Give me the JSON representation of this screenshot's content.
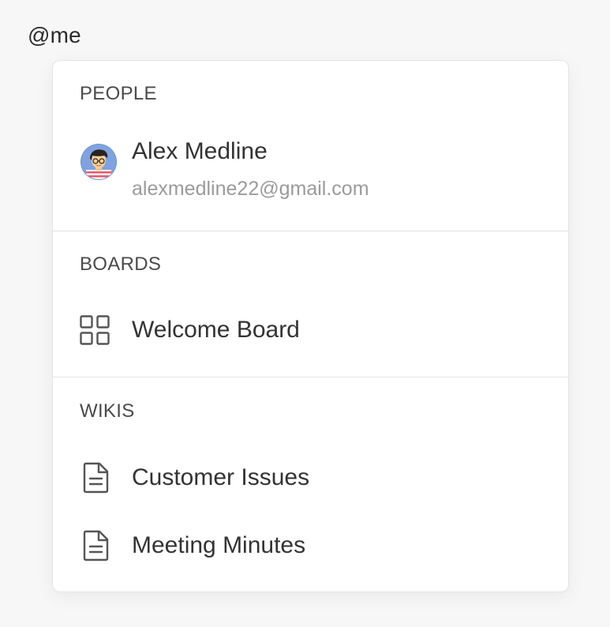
{
  "input": {
    "value": "@me"
  },
  "dropdown": {
    "people": {
      "header": "PEOPLE",
      "items": [
        {
          "name": "Alex Medline",
          "email": "alexmedline22@gmail.com",
          "icon": "avatar"
        }
      ]
    },
    "boards": {
      "header": "BOARDS",
      "items": [
        {
          "label": "Welcome Board",
          "icon": "board-grid-icon"
        }
      ]
    },
    "wikis": {
      "header": "WIKIS",
      "items": [
        {
          "label": "Customer Issues",
          "icon": "document-icon"
        },
        {
          "label": "Meeting Minutes",
          "icon": "document-icon"
        }
      ]
    }
  }
}
